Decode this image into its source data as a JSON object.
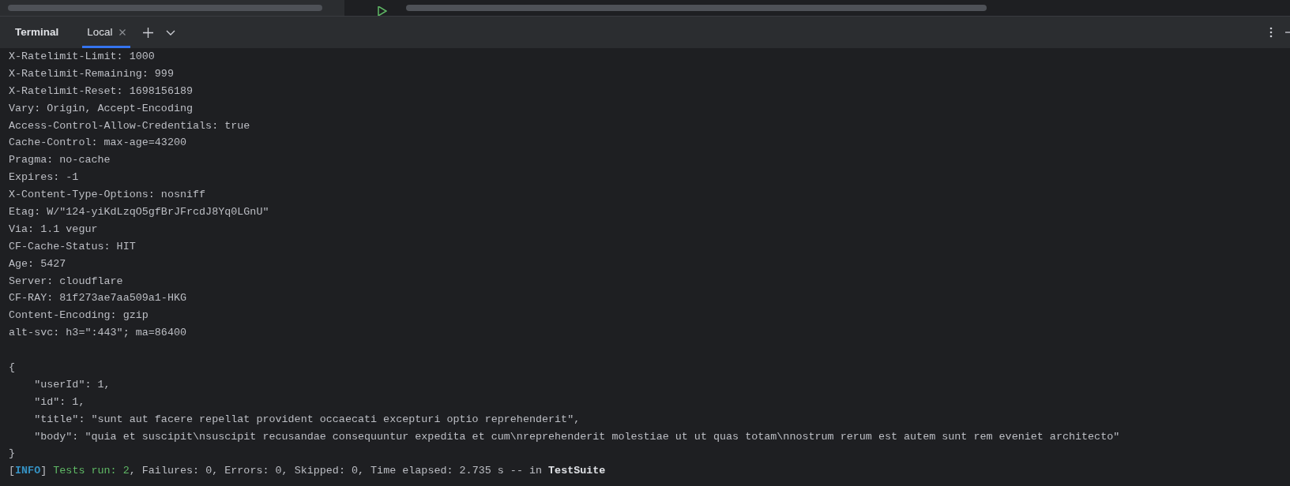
{
  "panel": {
    "title": "Terminal",
    "tabs": [
      {
        "label": "Local",
        "selected": true
      }
    ]
  },
  "output": [
    {
      "kind": "text",
      "text": "X-Ratelimit-Limit: 1000"
    },
    {
      "kind": "text",
      "text": "X-Ratelimit-Remaining: 999"
    },
    {
      "kind": "text",
      "text": "X-Ratelimit-Reset: 1698156189"
    },
    {
      "kind": "text",
      "text": "Vary: Origin, Accept-Encoding"
    },
    {
      "kind": "text",
      "text": "Access-Control-Allow-Credentials: true"
    },
    {
      "kind": "text",
      "text": "Cache-Control: max-age=43200"
    },
    {
      "kind": "text",
      "text": "Pragma: no-cache"
    },
    {
      "kind": "text",
      "text": "Expires: -1"
    },
    {
      "kind": "text",
      "text": "X-Content-Type-Options: nosniff"
    },
    {
      "kind": "text",
      "text": "Etag: W/\"124-yiKdLzqO5gfBrJFrcdJ8Yq0LGnU\""
    },
    {
      "kind": "text",
      "text": "Via: 1.1 vegur"
    },
    {
      "kind": "text",
      "text": "CF-Cache-Status: HIT"
    },
    {
      "kind": "text",
      "text": "Age: 5427"
    },
    {
      "kind": "text",
      "text": "Server: cloudflare"
    },
    {
      "kind": "text",
      "text": "CF-RAY: 81f273ae7aa509a1-HKG"
    },
    {
      "kind": "text",
      "text": "Content-Encoding: gzip"
    },
    {
      "kind": "text",
      "text": "alt-svc: h3=\":443\"; ma=86400"
    },
    {
      "kind": "blank"
    },
    {
      "kind": "text",
      "text": "{"
    },
    {
      "kind": "text",
      "text": "    \"userId\": 1,"
    },
    {
      "kind": "text",
      "text": "    \"id\": 1,"
    },
    {
      "kind": "text",
      "text": "    \"title\": \"sunt aut facere repellat provident occaecati excepturi optio reprehenderit\","
    },
    {
      "kind": "text",
      "text": "    \"body\": \"quia et suscipit\\nsuscipit recusandae consequuntur expedita et cum\\nreprehenderit molestiae ut ut quas totam\\nnostrum rerum est autem sunt rem eveniet architecto\""
    },
    {
      "kind": "text",
      "text": "}"
    },
    {
      "kind": "segments",
      "segments": [
        {
          "kind": "plain",
          "text": "["
        },
        {
          "kind": "info",
          "text": "INFO"
        },
        {
          "kind": "plain",
          "text": "] "
        },
        {
          "kind": "success",
          "text": "Tests run: 2"
        },
        {
          "kind": "plain",
          "text": ", Failures: 0, Errors: 0, Skipped: 0, Time elapsed: 2.735 s -- in "
        },
        {
          "kind": "bold",
          "text": "TestSuite"
        }
      ]
    }
  ]
}
